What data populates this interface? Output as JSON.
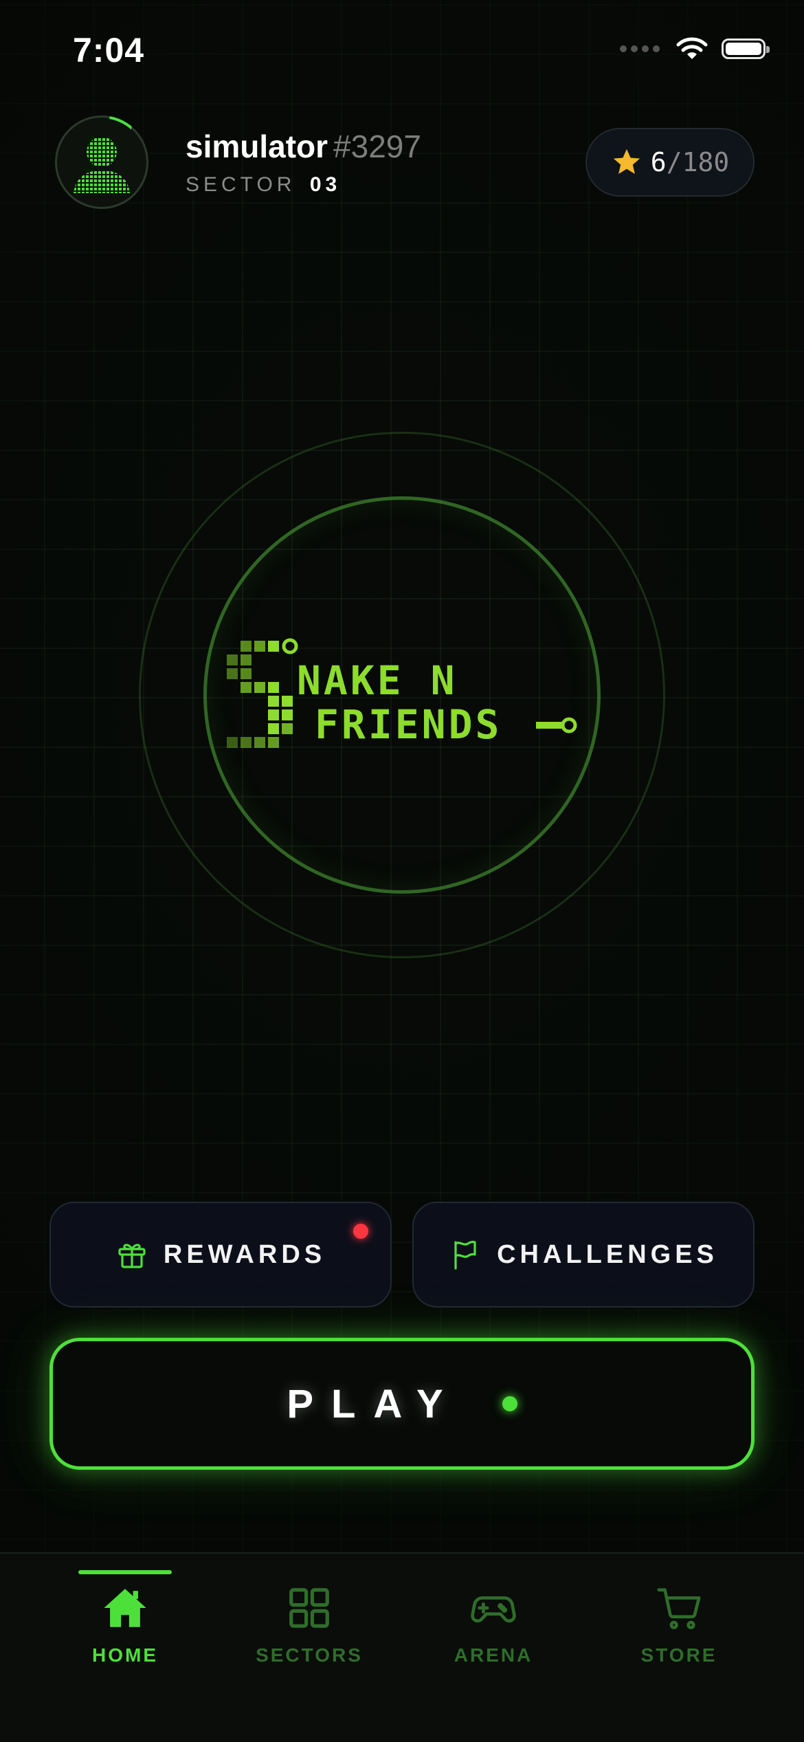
{
  "status_bar": {
    "time": "7:04"
  },
  "profile": {
    "username": "simulator",
    "tag": "#3297",
    "sector_label": "SECTOR",
    "sector_value": "03"
  },
  "stars": {
    "current": "6",
    "max": "/180"
  },
  "buttons": {
    "rewards": "REWARDS",
    "challenges": "CHALLENGES",
    "play": "PLAY"
  },
  "tabs": [
    {
      "label": "HOME",
      "icon": "home-icon",
      "active": true
    },
    {
      "label": "SECTORS",
      "icon": "grid-icon",
      "active": false
    },
    {
      "label": "ARENA",
      "icon": "gamepad-icon",
      "active": false
    },
    {
      "label": "STORE",
      "icon": "cart-icon",
      "active": false
    }
  ],
  "colors": {
    "accent": "#4ee03a",
    "notification": "#ff3540",
    "star": "#f5b82e",
    "background": "#070a07"
  }
}
